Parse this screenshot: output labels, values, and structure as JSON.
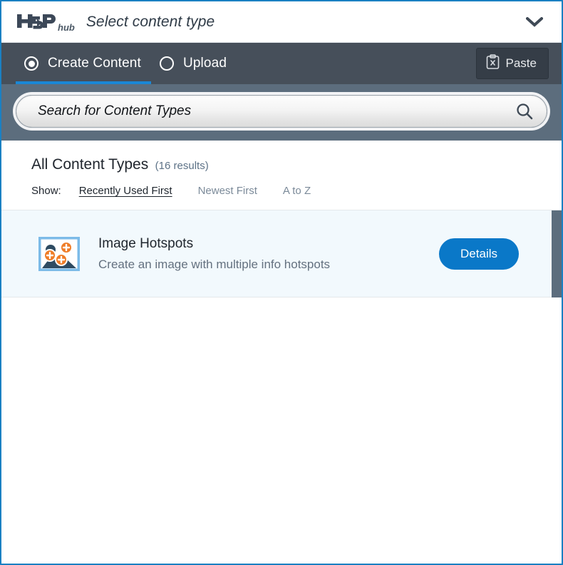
{
  "header": {
    "logo_text": "H5P",
    "logo_suffix": "hub",
    "title": "Select content type",
    "chevron_icon": "chevron-down-icon"
  },
  "modes": {
    "tabs": [
      {
        "label": "Create Content",
        "selected": true
      },
      {
        "label": "Upload",
        "selected": false
      }
    ],
    "paste": {
      "label": "Paste",
      "icon": "clipboard-paste-icon"
    }
  },
  "search": {
    "placeholder": "Search for Content Types",
    "value": "",
    "icon": "search-icon"
  },
  "results": {
    "title": "All Content Types",
    "count_label": "(16 results)",
    "sort": {
      "label": "Show:",
      "options": [
        {
          "label": "Recently Used First",
          "active": true
        },
        {
          "label": "Newest First",
          "active": false
        },
        {
          "label": "A to Z",
          "active": false
        }
      ]
    },
    "items": [
      {
        "title": "Image Hotspots",
        "description": "Create an image with multiple info hotspots",
        "icon": "image-hotspots-icon",
        "action_label": "Details"
      }
    ]
  },
  "colors": {
    "frame_border": "#1a80c3",
    "mode_bar": "#464f5a",
    "search_band": "#5c6d7d",
    "accent_blue": "#1a87d5",
    "details_button": "#0a78c8",
    "row_highlight": "#f2f9fd",
    "icon_orange": "#ef7d28",
    "icon_navy": "#2e4b62"
  }
}
